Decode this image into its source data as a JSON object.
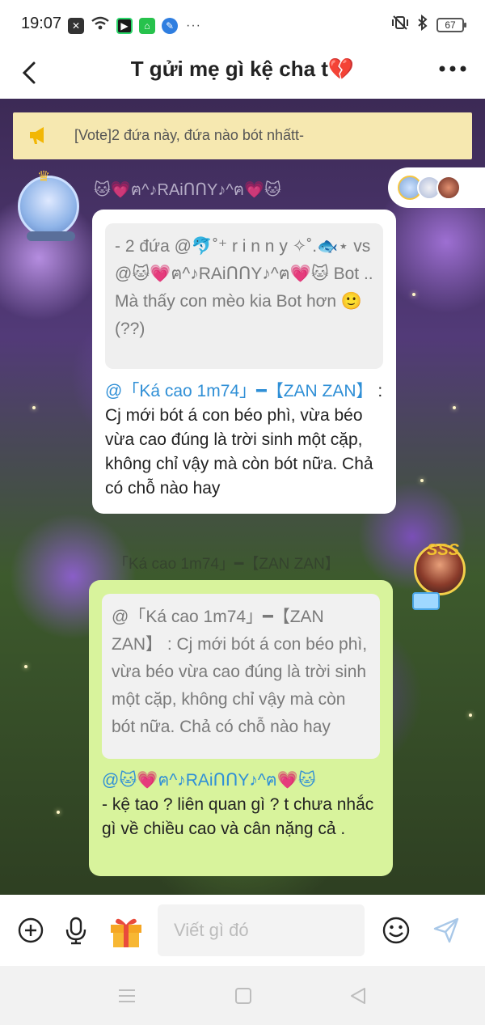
{
  "status_bar": {
    "time": "19:07",
    "battery": "67",
    "more": "···"
  },
  "header": {
    "title": "T gửi mẹ gì kệ cha t💔"
  },
  "announcement": {
    "text": "[Vote]2 đứa này, đứa nào bót nhấtt-"
  },
  "message1": {
    "sender_name": "🐱💗ฅ^♪RAiՈՈY♪^ฅ💗🐱",
    "quote": "- 2 đứa @🐬˚⁺ r i n n y ✧˚.🐟⋆ vs @🐱💗ฅ^♪RAiՈՈY♪^ฅ💗🐱  Bot .. Mà thấy con mèo kia Bot hơn 🙂 (??)",
    "mention": "@「Ká cao 1m74」━【ZAN ZAN】",
    "body": " : Cj mới bót á con béo phì, vừa béo vừa cao đúng là trời sinh một cặp, không chỉ vậy mà còn bót nữa. Chả có chỗ nào hay"
  },
  "message2": {
    "ghost_sender": "「Ká cao 1m74」━【ZAN ZAN】",
    "sticker_text": "SSS",
    "quote": "@「Ká cao 1m74」━【ZAN ZAN】 : Cj mới bót á con béo phì, vừa béo vừa cao đúng là trời sinh một cặp, không chỉ vậy mà còn bót nữa. Chả có chỗ nào hay",
    "mention": "@🐱💗ฅ^♪RAiՈՈY♪^ฅ💗🐱",
    "body": "- kệ tao ? liên quan gì ? t chưa nhắc gì về chiều cao và cân nặng cả ."
  },
  "input": {
    "placeholder": "Viết gì đó",
    "value": ""
  },
  "colors": {
    "accent": "#2f8fd6",
    "announce_bg": "#f6e8b0",
    "my_bubble": "#d8f39c",
    "heart": "#e0304a"
  },
  "icons": [
    "back-icon",
    "more-icon",
    "megaphone-icon",
    "plus-icon",
    "mic-icon",
    "gift-icon",
    "emoji-icon",
    "send-icon",
    "nav-menu-icon",
    "nav-home-icon",
    "nav-back-icon"
  ]
}
